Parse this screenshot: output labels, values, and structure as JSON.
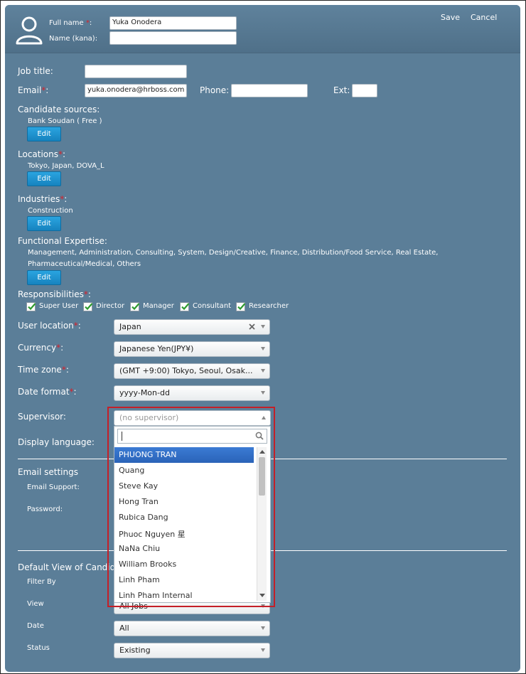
{
  "header": {
    "full_name_label": "Full name",
    "full_name_value": "Yuka Onodera",
    "name_kana_label": "Name (kana):",
    "name_kana_value": "",
    "save_label": "Save",
    "cancel_label": "Cancel"
  },
  "form": {
    "job_title_label": "Job title:",
    "job_title_value": "",
    "email_label": "Email",
    "email_value": "yuka.onodera@hrboss.com",
    "phone_label": "Phone:",
    "phone_value": "",
    "ext_label": "Ext:",
    "ext_value": "",
    "candidate_sources_label": "Candidate sources:",
    "candidate_sources_value": "Bank Soudan ( Free )",
    "locations_label": "Locations",
    "locations_value": "Tokyo, Japan, DOVA_L",
    "industries_label": "Industries",
    "industries_value": "Construction",
    "functional_expertise_label": "Functional Expertise:",
    "functional_expertise_line1": "Management, Administration, Consulting, System, Design/Creative, Finance, Distribution/Food Service, Real Estate,",
    "functional_expertise_line2": "Pharmaceutical/Medical, Others",
    "edit_label": "Edit",
    "responsibilities_label": "Responsibilities",
    "responsibilities": [
      "Super User",
      "Director",
      "Manager",
      "Consultant",
      "Researcher"
    ],
    "user_location_label": "User location",
    "user_location_value": "Japan",
    "currency_label": "Currency",
    "currency_value": "Japanese Yen(JPY¥)",
    "time_zone_label": "Time zone",
    "time_zone_value": "(GMT +9:00) Tokyo, Seoul, Osak...",
    "date_format_label": "Date format",
    "date_format_value": "yyyy-Mon-dd",
    "supervisor_label": "Supervisor:",
    "supervisor_value": "(no supervisor)",
    "display_language_label": "Display language:"
  },
  "email_settings": {
    "title": "Email settings",
    "email_support_label": "Email Support:",
    "password_label": "Password:"
  },
  "default_view": {
    "title": "Default View of Candida",
    "filter_by_label": "Filter By",
    "view_label": "View",
    "view_value": "All Jobs",
    "date_label": "Date",
    "date_value": "All",
    "status_label": "Status",
    "status_value": "Existing"
  },
  "supervisor_dropdown": {
    "search_value": "",
    "options": [
      "PHUONG TRAN",
      "Quang",
      "Steve Kay",
      "Hong Tran",
      "Rubica Dang",
      "Phuoc Nguyen 星",
      "NaNa Chiu",
      "William Brooks",
      "Linh Pham",
      "Linh Pham Internal"
    ],
    "highlighted_index": 0
  },
  "colors": {
    "panel_bg": "#5b7e98",
    "edit_button": "#1a8fcf",
    "highlight_option": "#3372c9",
    "required_mark": "#d6212a",
    "annotation_box": "#c41f28"
  }
}
